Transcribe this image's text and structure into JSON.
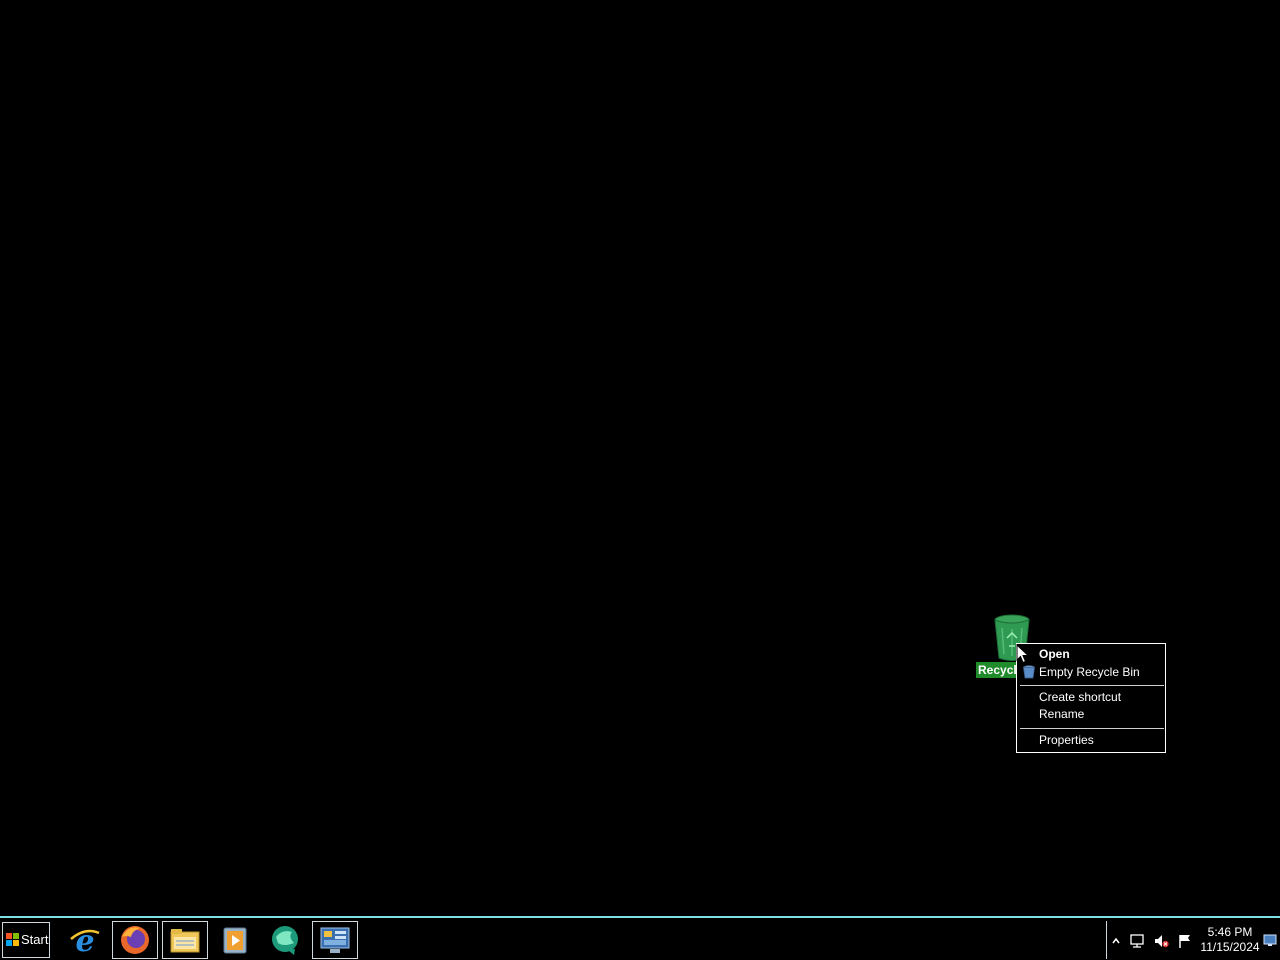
{
  "desktop": {
    "recycle_bin": {
      "label": "Recycle Bin",
      "icon": "recycle-bin-icon"
    }
  },
  "context_menu": {
    "items": [
      {
        "label": "Open",
        "default": true
      },
      {
        "label": "Empty Recycle Bin",
        "icon": "recycle-bin-icon"
      },
      {
        "separator": true
      },
      {
        "label": "Create shortcut"
      },
      {
        "label": "Rename"
      },
      {
        "separator": true
      },
      {
        "label": "Properties"
      }
    ]
  },
  "taskbar": {
    "start_label": "Start",
    "pinned": [
      {
        "name": "internet-explorer-icon"
      },
      {
        "name": "firefox-icon"
      },
      {
        "name": "file-explorer-icon"
      },
      {
        "name": "media-player-icon"
      },
      {
        "name": "green-globe-app-icon"
      },
      {
        "name": "control-panel-icon"
      }
    ],
    "tray": {
      "icons": [
        "show-hidden-icons-chevron",
        "network-icon",
        "volume-muted-icon",
        "action-center-flag-icon"
      ],
      "time": "5:46 PM",
      "date": "11/15/2024"
    }
  },
  "colors": {
    "desktop_bg": "#000000",
    "selection_label_bg": "#1f8b2a",
    "taskbar_border": "#7fe0e0"
  }
}
